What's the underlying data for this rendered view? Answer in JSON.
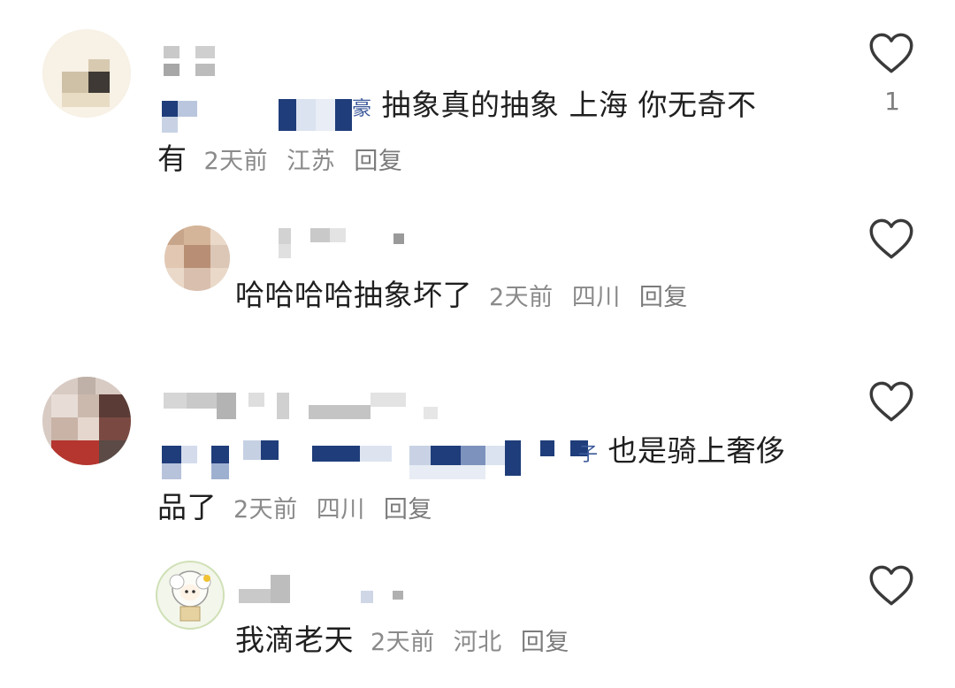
{
  "comments": [
    {
      "text_line1": "抽象真的抽象 上海 你无奇不",
      "text_line2": "有",
      "time": "2天前",
      "location": "江苏",
      "reply_label": "回复",
      "likes": "1",
      "visible_name_tail": "豪"
    },
    {
      "text_line1": "哈哈哈哈抽象坏了",
      "time": "2天前",
      "location": "四川",
      "reply_label": "回复"
    },
    {
      "text_line1": "也是骑上奢侈",
      "text_line2": "品了",
      "time": "2天前",
      "location": "四川",
      "reply_label": "回复",
      "visible_name_tail": "子"
    },
    {
      "text_line1": "我滴老天",
      "time": "2天前",
      "location": "河北",
      "reply_label": "回复"
    }
  ],
  "icons": {
    "like": "heart-outline-icon"
  },
  "colors": {
    "text": "#1f1f1f",
    "meta": "#8a8a8a",
    "mosaic_blue": "#1f3d7a"
  }
}
